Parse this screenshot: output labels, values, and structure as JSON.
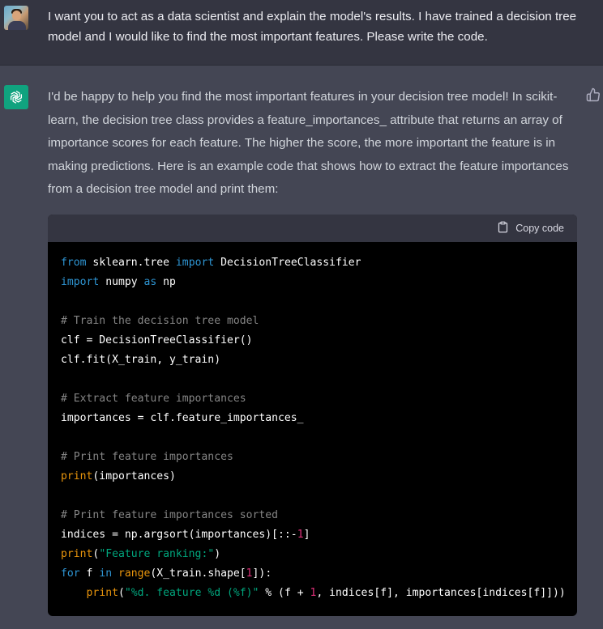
{
  "user_message": {
    "text": "I want you to act as a data scientist and explain the model's results. I have trained a decision tree model and I would like to find the most important features. Please write the code."
  },
  "assistant_message": {
    "text": "I'd be happy to help you find the most important features in your decision tree model! In scikit-learn, the decision tree class provides a feature_importances_ attribute that returns an array of importance scores for each feature. The higher the score, the more important the feature is in making predictions. Here is an example code that shows how to extract the feature importances from a decision tree model and print them:",
    "code_block": {
      "copy_label": "Copy code",
      "language": "python",
      "lines": [
        "from sklearn.tree import DecisionTreeClassifier",
        "import numpy as np",
        "",
        "# Train the decision tree model",
        "clf = DecisionTreeClassifier()",
        "clf.fit(X_train, y_train)",
        "",
        "# Extract feature importances",
        "importances = clf.feature_importances_",
        "",
        "# Print feature importances",
        "print(importances)",
        "",
        "# Print feature importances sorted",
        "indices = np.argsort(importances)[::-1]",
        "print(\"Feature ranking:\")",
        "for f in range(X_train.shape[1]):",
        "    print(\"%d. feature %d (%f)\" % (f + 1, indices[f], importances[indices[f]]))"
      ]
    }
  },
  "icons": {
    "user_avatar": "user-avatar",
    "assistant_avatar": "openai-logo-icon",
    "feedback": "thumbs-up-icon",
    "copy": "clipboard-icon"
  },
  "colors": {
    "background": "#444654",
    "user_background": "#343541",
    "assistant_avatar": "#10a37f",
    "code_background": "#000000",
    "keyword": "#2e95d3",
    "builtin": "#e9950c",
    "string": "#00a67d",
    "number": "#df3079",
    "comment": "#858585"
  }
}
